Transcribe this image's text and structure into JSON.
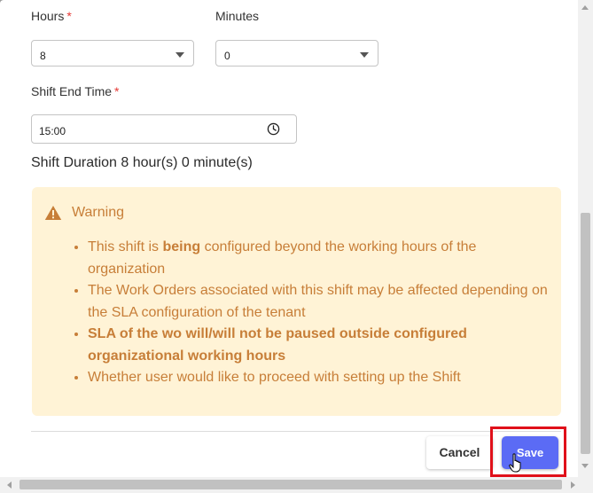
{
  "form": {
    "hours": {
      "label": "Hours",
      "required_mark": "*",
      "value": "8"
    },
    "minutes": {
      "label": "Minutes",
      "value": "0"
    },
    "shift_end": {
      "label": "Shift End Time",
      "required_mark": "*",
      "value": "15:00",
      "icon": "clock-icon"
    },
    "duration_text": "Shift Duration 8 hour(s) 0 minute(s)"
  },
  "warning": {
    "icon": "warning-triangle-icon",
    "title": "Warning",
    "items": [
      {
        "pre": "This shift is ",
        "bold": "being",
        "post": " configured beyond the working hours of the organization"
      },
      {
        "text": "The Work Orders associated with this shift may be affected depending on the SLA configuration of the tenant"
      },
      {
        "bold_text": "SLA of the wo will/will not be paused outside configured organizational working hours"
      },
      {
        "text": "Whether user would like to proceed with setting up the Shift"
      }
    ]
  },
  "actions": {
    "cancel_label": "Cancel",
    "save_label": "Save"
  },
  "colors": {
    "accent": "#5b6bf5",
    "warning_bg": "#fff3d6",
    "warning_text": "#c77e38",
    "required": "#e53935",
    "highlight": "#e0101a"
  }
}
